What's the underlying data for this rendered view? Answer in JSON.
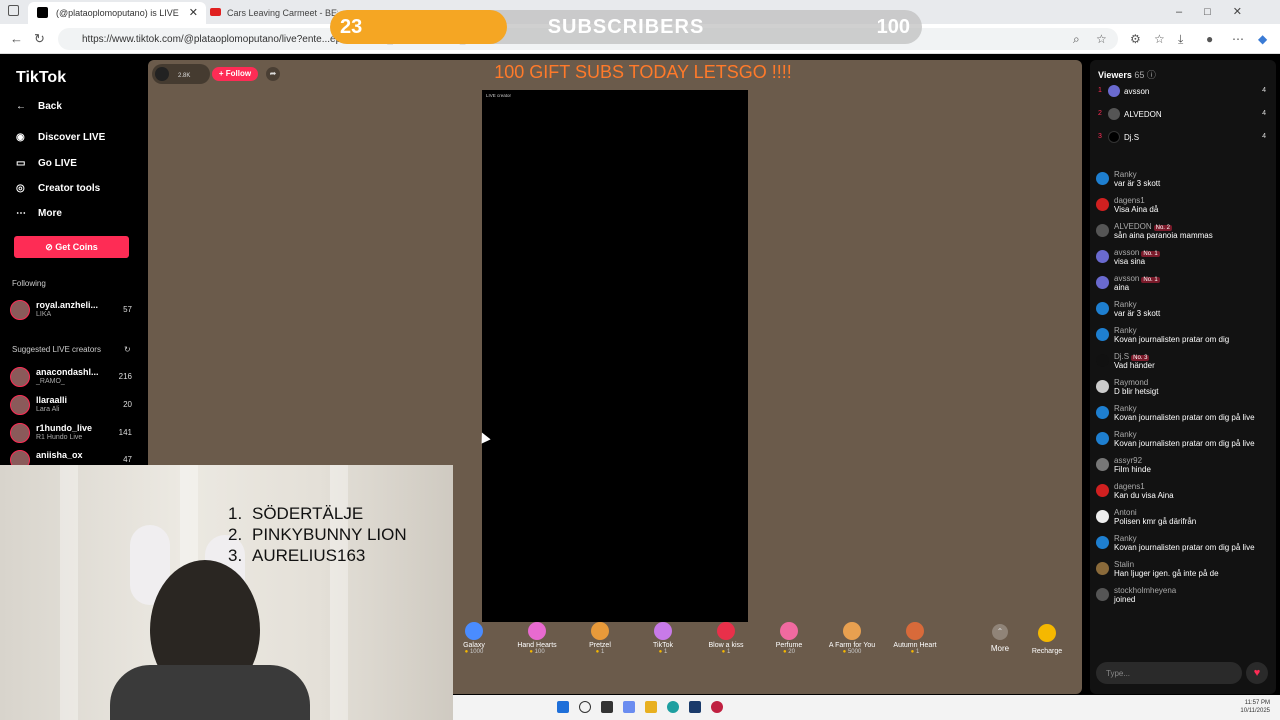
{
  "browser": {
    "tabs": [
      {
        "title": "(@plataoplomoputano) is LIVE"
      },
      {
        "title": "Cars Leaving Carmeet - BEST"
      }
    ],
    "url": "https://www.tiktok.com/@plataoplomoputano/live?ente...epage&enter_method=others_photo"
  },
  "sidebar": {
    "logo": "TikTok",
    "nav": [
      {
        "label": "Back",
        "icon": "back-arrow-icon"
      },
      {
        "label": "Discover LIVE",
        "icon": "live-icon"
      },
      {
        "label": "Go LIVE",
        "icon": "camera-icon"
      },
      {
        "label": "Creator tools",
        "icon": "lightbulb-icon"
      },
      {
        "label": "More",
        "icon": "ellipsis-icon"
      }
    ],
    "get_coins": "Get Coins",
    "following_label": "Following",
    "following": [
      {
        "name": "royal.anzheli...",
        "sub": "LIKA",
        "count": "57"
      }
    ],
    "suggested_label": "Suggested LIVE creators",
    "suggested": [
      {
        "name": "anacondashl...",
        "sub": "_RAMO_",
        "count": "216"
      },
      {
        "name": "llaraalli",
        "sub": "Lara Ali",
        "count": "20"
      },
      {
        "name": "r1hundo_live",
        "sub": "R1 Hundo Live",
        "count": "141"
      },
      {
        "name": "aniisha_ox",
        "sub": "",
        "count": "47"
      }
    ]
  },
  "stage": {
    "host_likes": "2.8K",
    "follow": "+ Follow",
    "banner": "100 GIFT SUBS TODAY LETSGO !!!!",
    "live_label": "LIVE creator",
    "gifts": [
      {
        "name": "Galaxy",
        "price": "1000",
        "color": "#4a8cff"
      },
      {
        "name": "Hand Hearts",
        "price": "100",
        "color": "#e86ad0"
      },
      {
        "name": "Pretzel",
        "price": "1",
        "color": "#e89a3a"
      },
      {
        "name": "TikTok",
        "price": "1",
        "color": "#c87ae8"
      },
      {
        "name": "Blow a kiss",
        "price": "1",
        "color": "#e8304a"
      },
      {
        "name": "Perfume",
        "price": "20",
        "color": "#f06aa0"
      },
      {
        "name": "A Farm for You",
        "price": "5000",
        "color": "#e8a050"
      },
      {
        "name": "Autumn Heart",
        "price": "1",
        "color": "#d86a3a"
      }
    ],
    "more": "More",
    "recharge": "Recharge"
  },
  "chat": {
    "viewers_title": "Viewers",
    "viewers_count": "65",
    "viewers": [
      {
        "rank": "1",
        "name": "avsson",
        "score": "4",
        "color": "#6a6acf"
      },
      {
        "rank": "2",
        "name": "ALVEDON",
        "score": "4",
        "color": "#444"
      },
      {
        "rank": "3",
        "name": "Dj.S",
        "score": "4",
        "color": "#111"
      }
    ],
    "messages": [
      {
        "user": "Ranky",
        "badge": "",
        "text": "var är 3 skott",
        "color": "#1e7fd0"
      },
      {
        "user": "dagens1",
        "badge": "",
        "text": "Visa Aina då",
        "color": "#d02020"
      },
      {
        "user": "ALVEDON",
        "badge": "No. 2",
        "text": "sån aina paranoia mammas",
        "color": "#555"
      },
      {
        "user": "avsson",
        "badge": "No. 1",
        "text": "visa sina",
        "color": "#6a6acf"
      },
      {
        "user": "avsson",
        "badge": "No. 1",
        "text": "aina",
        "color": "#6a6acf"
      },
      {
        "user": "Ranky",
        "badge": "",
        "text": "var är 3 skott",
        "color": "#1e7fd0"
      },
      {
        "user": "Ranky",
        "badge": "",
        "text": "Kovan journalisten pratar om dig",
        "color": "#1e7fd0"
      },
      {
        "user": "Dj.S",
        "badge": "No. 3",
        "text": "Vad händer",
        "color": "#111"
      },
      {
        "user": "Raymond",
        "badge": "",
        "text": "D blir hetsigt",
        "color": "#ccc"
      },
      {
        "user": "Ranky",
        "badge": "",
        "text": "Kovan journalisten pratar om dig på live",
        "color": "#1e7fd0"
      },
      {
        "user": "Ranky",
        "badge": "",
        "text": "Kovan journalisten pratar om dig på live",
        "color": "#1e7fd0"
      },
      {
        "user": "assyr92",
        "badge": "",
        "text": "Film hinde",
        "color": "#777"
      },
      {
        "user": "dagens1",
        "badge": "",
        "text": "Kan du visa Aina",
        "color": "#d02020"
      },
      {
        "user": "Antoni",
        "badge": "",
        "text": "Polisen kmr gå därifrån",
        "color": "#eee"
      },
      {
        "user": "Ranky",
        "badge": "",
        "text": "Kovan journalisten pratar om dig på live",
        "color": "#1e7fd0"
      },
      {
        "user": "Stalin",
        "badge": "",
        "text": "Han ljuger igen. gå inte på de",
        "color": "#8a6a3a"
      },
      {
        "user": "stockholmheyena",
        "badge": "",
        "text": "joined",
        "color": "#555"
      }
    ],
    "input_placeholder": "Type..."
  },
  "overlay": {
    "subs_current": "23",
    "subs_label": "SUBSCRIBERS",
    "subs_goal": "100",
    "subs_progress_fraction": 0.23,
    "top_list": [
      "SÖDERTÄLJE",
      "PINKYBUNNY LION",
      "AURELIUS163"
    ]
  },
  "taskbar": {
    "time": "11:57 PM",
    "date": "10/11/2025"
  }
}
